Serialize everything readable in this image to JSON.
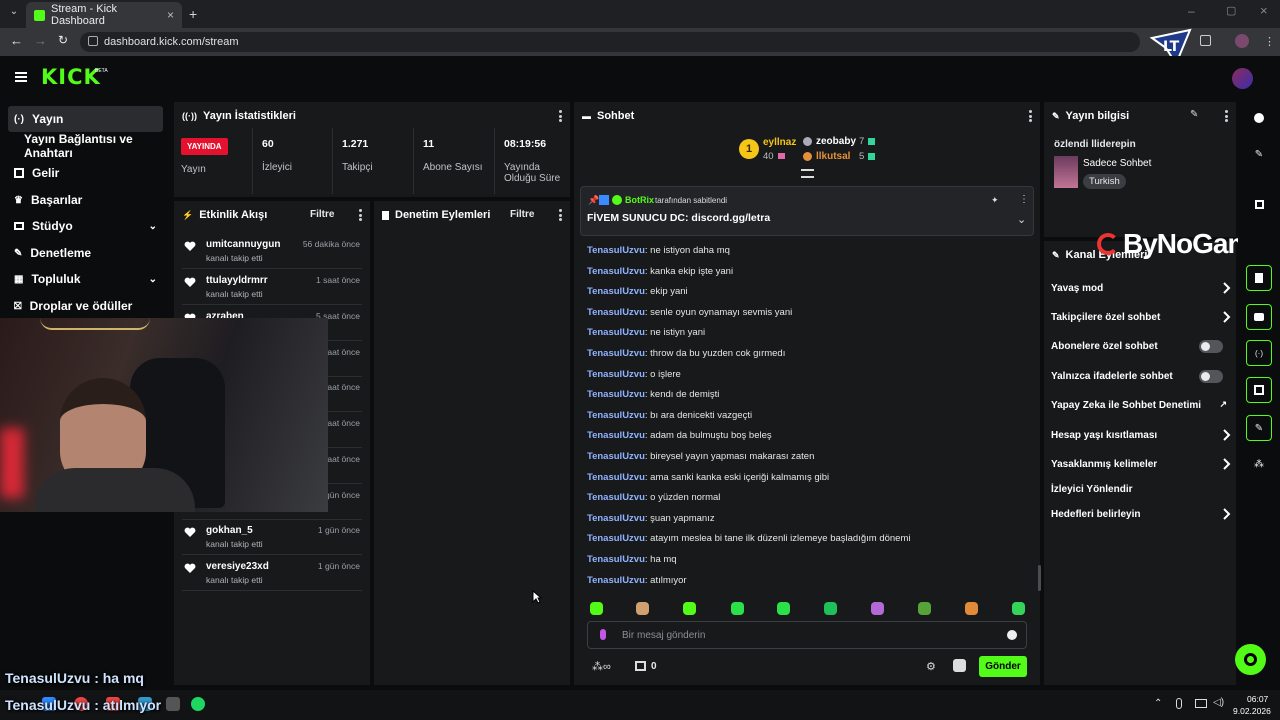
{
  "browser": {
    "tab_title": "Stream - Kick Dashboard",
    "url": "dashboard.kick.com/stream"
  },
  "header": {
    "logo": "KICK",
    "beta": "BETA"
  },
  "nav": [
    {
      "label": "Yayın",
      "icon": "broadcast-icon",
      "active": true
    },
    {
      "label": "Yayın Bağlantısı ve Anahtarı",
      "icon": "",
      "active": false
    },
    {
      "label": "Gelir",
      "icon": "revenue-icon",
      "active": false
    },
    {
      "label": "Başarılar",
      "icon": "trophy-icon",
      "active": false
    },
    {
      "label": "Stüdyo",
      "icon": "studio-icon",
      "active": false,
      "expand": true
    },
    {
      "label": "Denetleme",
      "icon": "wrench-icon",
      "active": false
    },
    {
      "label": "Topluluk",
      "icon": "community-icon",
      "active": false,
      "expand": true
    },
    {
      "label": "Droplar ve ödüller",
      "icon": "gift-icon",
      "active": false
    }
  ],
  "stats": {
    "title": "Yayın İstatistikleri",
    "live_badge": "YAYINDA",
    "status_label": "Yayın",
    "viewers_value": "60",
    "viewers_label": "İzleyici",
    "followers_value": "1.271",
    "followers_label": "Takipçi",
    "subs_value": "11",
    "subs_label": "Abone Sayısı",
    "uptime_value": "08:19:56",
    "uptime_label": "Yayında Olduğu Süre"
  },
  "activity": {
    "title": "Etkinlik Akışı",
    "filter": "Filtre",
    "rows": [
      {
        "user": "umitcannuygun",
        "sub": "kanalı takip etti",
        "time": "56 dakika önce"
      },
      {
        "user": "ttulayyldrmrr",
        "sub": "kanalı takip etti",
        "time": "1 saat önce"
      },
      {
        "user": "azraben",
        "sub": "",
        "time": "5 saat önce"
      },
      {
        "user": "",
        "sub": "",
        "time": "saat önce"
      },
      {
        "user": "",
        "sub": "",
        "time": "saat önce"
      },
      {
        "user": "",
        "sub": "",
        "time": "saat önce"
      },
      {
        "user": "",
        "sub": "",
        "time": "saat önce"
      },
      {
        "user": "",
        "sub": "",
        "time": "gün önce"
      },
      {
        "user": "gokhan_5",
        "sub": "kanalı takip etti",
        "time": "1 gün önce"
      },
      {
        "user": "veresiye23xd",
        "sub": "kanalı takip etti",
        "time": "1 gün önce"
      }
    ]
  },
  "moderation": {
    "title": "Denetim Eylemleri",
    "filter": "Filtre"
  },
  "chat": {
    "title": "Sohbet",
    "leaderboard": [
      {
        "rank": "1",
        "name": "eyllnaz",
        "score": "40"
      },
      {
        "name": "zeobaby",
        "score": "7"
      },
      {
        "name": "llkutsal",
        "score": "5"
      }
    ],
    "pinned_by": "BotRix",
    "pinned_suffix": "tarafından sabitlendi",
    "pinned_message": "FİVEM SUNUCU DC: discord.gg/letra",
    "messages": [
      {
        "user": "TenasulUzvu",
        "text": ": ne istiyon daha mq"
      },
      {
        "user": "TenasulUzvu",
        "text": ": kanka ekip işte yani"
      },
      {
        "user": "TenasulUzvu",
        "text": ": ekip yani"
      },
      {
        "user": "TenasulUzvu",
        "text": ": senle oyun oynamayı sevmis yani"
      },
      {
        "user": "TenasulUzvu",
        "text": ": ne istiyn yani"
      },
      {
        "user": "TenasulUzvu",
        "text": ": throw da bu yuzden cok gırmedı"
      },
      {
        "user": "TenasulUzvu",
        "text": ": o işlere"
      },
      {
        "user": "TenasulUzvu",
        "text": ": kendı de demişti"
      },
      {
        "user": "TenasulUzvu",
        "text": ": bı ara denicekti vazgeçti"
      },
      {
        "user": "TenasulUzvu",
        "text": ": adam da bulmuştu boş beleş"
      },
      {
        "user": "TenasulUzvu",
        "text": ": bireysel yayın yapması makarası zaten"
      },
      {
        "user": "TenasulUzvu",
        "text": ": ama sanki kanka eski içeriği kalmamış gibi"
      },
      {
        "user": "TenasulUzvu",
        "text": ": o yüzden normal"
      },
      {
        "user": "TenasulUzvu",
        "text": ": şuan yapmanız"
      },
      {
        "user": "TenasulUzvu",
        "text": ": atayım meslea bi tane ilk düzenli izlemeye başladığım dönemi"
      },
      {
        "user": "TenasulUzvu",
        "text": ": ha mq"
      },
      {
        "user": "TenasulUzvu",
        "text": ": atılmıyor"
      }
    ],
    "input_placeholder": "Bir mesaj gönderin",
    "points": "0",
    "send": "Gönder"
  },
  "info": {
    "title": "Yayın bilgisi",
    "stream_title": "özlendi lliderepin",
    "category": "Sadece Sohbet",
    "language": "Turkish"
  },
  "channel": {
    "title": "Kanal Eylemleri",
    "options": [
      {
        "label": "Yavaş mod",
        "kind": "chevron"
      },
      {
        "label": "Takipçilere özel sohbet",
        "kind": "chevron"
      },
      {
        "label": "Abonelere özel sohbet",
        "kind": "toggle"
      },
      {
        "label": "Yalnızca ifadelerle sohbet",
        "kind": "toggle"
      },
      {
        "label": "Yapay Zeka ile Sohbet Denetimi",
        "kind": "external"
      },
      {
        "label": "Hesap yaşı kısıtlaması",
        "kind": "chevron"
      },
      {
        "label": "Yasaklanmış kelimeler",
        "kind": "chevron"
      },
      {
        "label": "İzleyici Yönlendir",
        "kind": "none"
      },
      {
        "label": "Hedefleri belirleyin",
        "kind": "chevron"
      }
    ]
  },
  "overlay": {
    "watermark": "ByNoGame",
    "chat_line1": "TenasulUzvu : ha mq",
    "chat_line2": "TenasulUzvu : atılmıyor"
  },
  "taskbar": {
    "time": "06:07",
    "date": "9.02.2026"
  },
  "colors": {
    "kick_green": "#53fc18",
    "live_red": "#e4122e",
    "panel": "#18191b",
    "chat_user": "#8fb3ff"
  }
}
